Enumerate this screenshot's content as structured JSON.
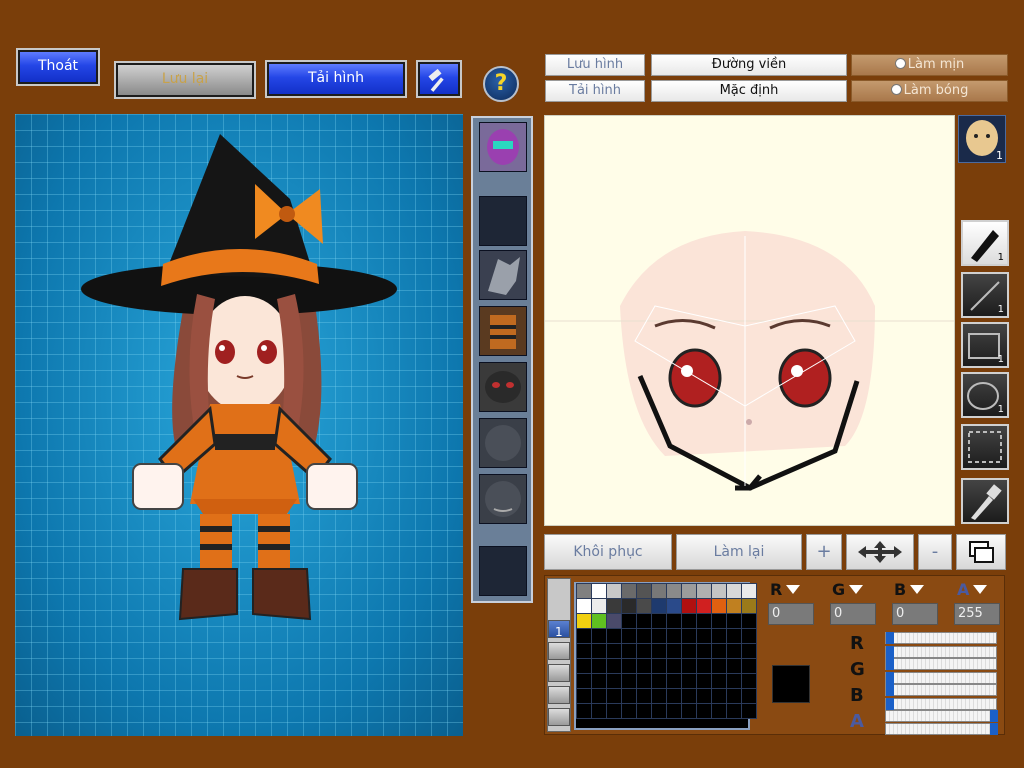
{
  "top_buttons": {
    "exit": "Thoát",
    "save": "Lưu lại",
    "load": "Tải hình"
  },
  "toolbar": {
    "save_image": "Lưu hình",
    "outline": "Đường viền",
    "smooth": "Làm mịn",
    "load_image": "Tải hình",
    "default": "Mặc định",
    "shade": "Làm bóng"
  },
  "tools": {
    "pen_count": "1",
    "line_count": "1",
    "rect_count": "1",
    "ellipse_count": "1"
  },
  "face_badge": "1",
  "bottom_buttons": {
    "restore": "Khôi phục",
    "redo": "Làm lại",
    "zoom_in": "+",
    "zoom_out": "-"
  },
  "color": {
    "labels": {
      "r": "R",
      "g": "G",
      "b": "B",
      "a": "A"
    },
    "values": {
      "r": "0",
      "g": "0",
      "b": "0",
      "a": "255"
    },
    "current": "#000000",
    "sliders": {
      "r": 0,
      "g": 0,
      "b": 0,
      "a": 255
    }
  },
  "palette_row1": [
    "#808080",
    "#ffffff",
    "#c8c8c8",
    "#6a6a6a",
    "#545454",
    "#787878",
    "#8a8a8a",
    "#9c9c9c",
    "#b0b0b0",
    "#c4c4c4",
    "#d8d8d8",
    "#eaeaea"
  ],
  "palette_row2": [
    "#ffffff",
    "#ececec",
    "#3a3a3a",
    "#2a2a2a",
    "#4a4a4a",
    "#1e3a6e",
    "#2a4a8a",
    "#b01010",
    "#d02020",
    "#e06010",
    "#c08020",
    "#9a7a1a"
  ],
  "palette_row3": [
    "#f0d010",
    "#60c020",
    "#4a4a6a"
  ],
  "palette_tab": "1",
  "accent": "#2446e6"
}
